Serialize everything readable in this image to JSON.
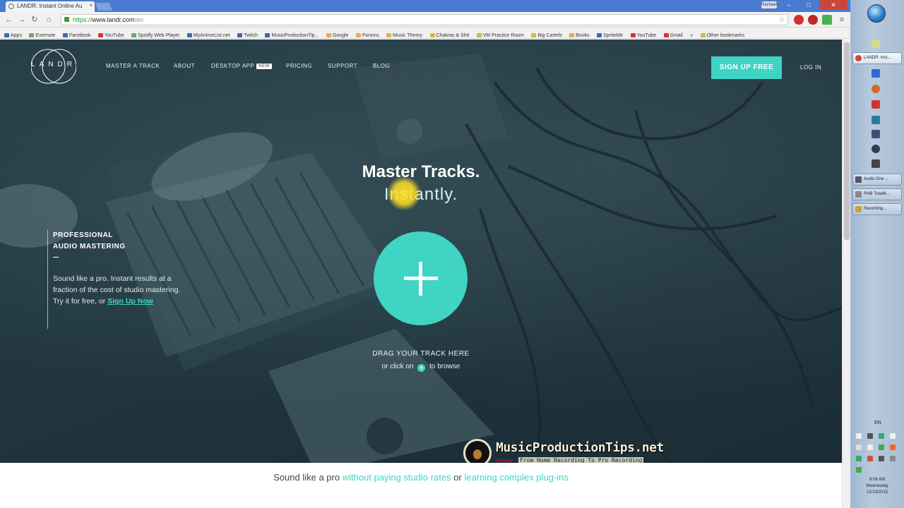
{
  "browser": {
    "tab_title": "LANDR: Instant Online Au",
    "tab_close": "×",
    "user_badge": "Rachael",
    "url_scheme": "https://",
    "url_host": "www.landr.com",
    "url_path": "/en",
    "window_controls": [
      "–",
      "□",
      "✕"
    ],
    "bookmarks": [
      "Apps",
      "Evernote",
      "Facebook",
      "YouTube",
      "Spotify Web Player",
      "MyAnimeList.net",
      "Twitch",
      "MusicProductionTip...",
      "Google",
      "Forums",
      "Music Theory",
      "Chakras & Shit",
      "VM Practice Room",
      "Big Cartels",
      "Books",
      "SpriteMe",
      "YouTube",
      "Gmail",
      "»",
      "Other bookmarks"
    ]
  },
  "nav": {
    "logo": "LANDR",
    "items": [
      "MASTER A TRACK",
      "ABOUT",
      "DESKTOP APP",
      "PRICING",
      "SUPPORT",
      "BLOG"
    ],
    "new_badge": "NEW",
    "signup": "SIGN UP FREE",
    "login": "LOG IN"
  },
  "hero": {
    "headline": "Master Tracks.",
    "subline": "Instantly.",
    "drag_label": "DRAG YOUR TRACK HERE",
    "browse_prefix": "or click on",
    "browse_suffix": "to browse"
  },
  "left_copy": {
    "heading_line1": "PROFESSIONAL",
    "heading_line2": "AUDIO MASTERING",
    "body": "Sound like a pro. Instant results at a fraction of the cost of studio mastering. Try it for free, or",
    "link": "Sign Up Now"
  },
  "tagline": {
    "part1": "Sound like a pro",
    "hl1": "without paying studio rates",
    "part2": "or",
    "hl2": "learning complex plug-ins"
  },
  "watermark": {
    "title": "MusicProductionTips.net",
    "forums": "forums",
    "sub": "From Home Recording To Pro Recording"
  },
  "taskbar": {
    "items": [
      "LANDR: Inst...",
      "Audio One ...",
      "RNB TotalM...",
      "Recording..."
    ],
    "lang": "EN",
    "time": "8:06 AM",
    "day": "Wednesday",
    "date": "12/23/2015"
  },
  "colors": {
    "accent": "#3fd4c4",
    "hero_bg": "#223740",
    "cursor_highlight": "#ffe028"
  }
}
